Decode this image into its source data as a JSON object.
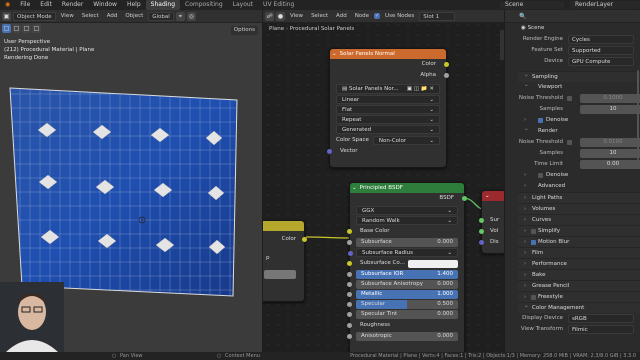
{
  "topbar": {
    "menus": [
      "File",
      "Edit",
      "Render",
      "Window",
      "Help"
    ],
    "workspaces": [
      "Shading",
      "Compositing",
      "Layout",
      "UV Editing"
    ],
    "active_workspace": "Shading",
    "scene": "Scene",
    "render_layer": "RenderLayer"
  },
  "viewport": {
    "mode": "Object Mode",
    "menus": [
      "View",
      "Select",
      "Add",
      "Object"
    ],
    "transform": "Global",
    "options": "Options",
    "info_line1": "User Perspective",
    "info_line2": "(212) Procedural Material | Plane",
    "info_line3": "Rendering Done"
  },
  "node_editor": {
    "object": "Plane",
    "material": "Procedural Solar Panels",
    "menus": [
      "View",
      "Select",
      "Add",
      "Node"
    ],
    "use_nodes": "Use Nodes",
    "slot": "Slot 1",
    "image_node": {
      "title": "Solar Panels Normal",
      "out_color": "Color",
      "out_alpha": "Alpha",
      "image_name": "Solar Panels Nor...",
      "interpolation": "Linear",
      "projection": "Flat",
      "extension": "Repeat",
      "source": "Generated",
      "color_space_label": "Color Space",
      "color_space": "Non-Color",
      "in_vector": "Vector"
    },
    "bsdf_node": {
      "title": "Principled BSDF",
      "out": "BSDF",
      "distribution": "GGX",
      "sss_method": "Random Walk",
      "base_color": "Base Color",
      "rows": [
        {
          "label": "Subsurface",
          "value": "0.000"
        },
        {
          "label": "Subsurface Radius",
          "value": ""
        },
        {
          "label": "Subsurface Co...",
          "value": ""
        },
        {
          "label": "Subsurface IOR",
          "value": "1.400"
        },
        {
          "label": "Subsurface Anisotropy",
          "value": "0.000"
        },
        {
          "label": "Metallic",
          "value": "1.000"
        },
        {
          "label": "Specular",
          "value": "0.500"
        },
        {
          "label": "Specular Tint",
          "value": "0.000"
        },
        {
          "label": "Roughness",
          "value": ""
        },
        {
          "label": "Anisotropic",
          "value": "0.000"
        }
      ]
    },
    "left_node_out": "Color",
    "left_node_frag": "p",
    "right_node_items": [
      "Sur",
      "Vol",
      "Dis"
    ]
  },
  "properties": {
    "scene": "Scene",
    "render_engine_label": "Render Engine",
    "render_engine": "Cycles",
    "feature_set_label": "Feature Set",
    "feature_set": "Supported",
    "device_label": "Device",
    "device": "GPU Compute",
    "sampling": "Sampling",
    "viewport": "Viewport",
    "noise_threshold_label": "Noise Threshold",
    "vp_noise_threshold": "0.1000",
    "samples_label": "Samples",
    "vp_samples": "10",
    "denoise": "Denoise",
    "render": "Render",
    "r_noise_threshold": "0.0100",
    "r_samples": "10",
    "time_limit_label": "Time Limit",
    "time_limit": "0.00",
    "advanced": "Advanced",
    "sections": [
      "Light Paths",
      "Volumes",
      "Curves",
      "Simplify",
      "Motion Blur",
      "Film",
      "Performance",
      "Bake",
      "Grease Pencil",
      "Freestyle"
    ],
    "color_management": "Color Management",
    "display_device_label": "Display Device",
    "display_device": "sRGB",
    "view_transform_label": "View Transform",
    "view_transform": "Filmic"
  },
  "statusbar": {
    "left": "Pan View",
    "mid": "Context Menu",
    "right": "Procedural Material | Plane | Verts:4 | Faces:1 | Tris:2 | Objects:1/3 | Memory: 258.0 MiB | VRAM: 2.3/8.0 GiB | 3.3.0"
  }
}
